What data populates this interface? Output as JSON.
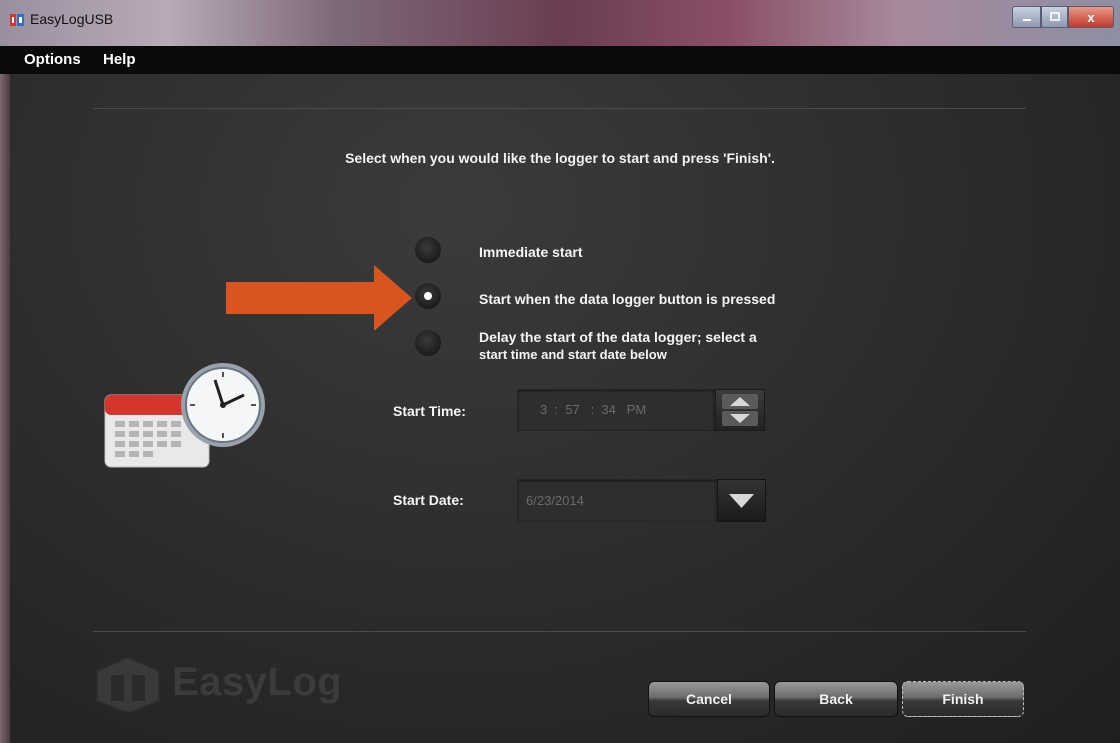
{
  "window": {
    "title": "EasyLogUSB",
    "controls": {
      "minimize": "",
      "maximize": "",
      "close": "x"
    }
  },
  "menu": {
    "items": [
      "Options",
      "Help"
    ]
  },
  "instruction": "Select when you would like the logger to start and press 'Finish'.",
  "start_options": {
    "selected_index": 1,
    "items": [
      {
        "line1": "Immediate start",
        "line2": ""
      },
      {
        "line1": "Start when the data logger button is pressed",
        "line2": ""
      },
      {
        "line1": "Delay the start of the data logger; select a",
        "line2": "start time and start date below"
      }
    ]
  },
  "start_time": {
    "label": "Start Time:",
    "value": "3  :  57   :  34   PM"
  },
  "start_date": {
    "label": "Start Date:",
    "value": "6/23/2014"
  },
  "branding": {
    "logo_text": "EasyLog"
  },
  "buttons": {
    "cancel": "Cancel",
    "back": "Back",
    "finish": "Finish"
  },
  "colors": {
    "arrow": "#d9541e",
    "calendar_red": "#d6352b",
    "background": "#2a2a2a"
  },
  "icons": {
    "arrow": "orange-arrow-icon",
    "calendar_clock": "calendar-clock-icon",
    "spin": "up-down-spinner-icon",
    "dropdown": "chevron-down-icon",
    "logo": "easylog-logo-icon"
  }
}
